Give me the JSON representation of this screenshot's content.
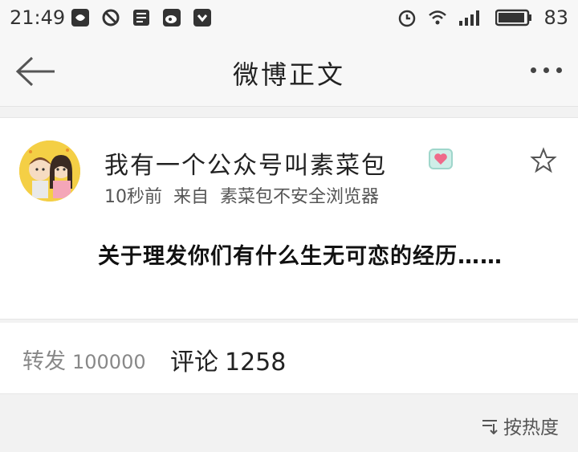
{
  "status_bar": {
    "time": "21:49",
    "battery": "83"
  },
  "nav": {
    "title": "微博正文"
  },
  "post": {
    "author": "我有一个公众号叫素菜包",
    "time": "10秒前",
    "from_label": "来自",
    "source": "素菜包不安全浏览器",
    "text": "关于理发你们有什么生无可恋的经历……"
  },
  "stats": {
    "repost_label": "转发",
    "repost_count": "100000",
    "comment_label": "评论",
    "comment_count": "1258"
  },
  "sort": {
    "label": "按热度"
  },
  "colors": {
    "background": "#f2f2f2",
    "card": "#ffffff",
    "badge": "#cfeee8"
  }
}
